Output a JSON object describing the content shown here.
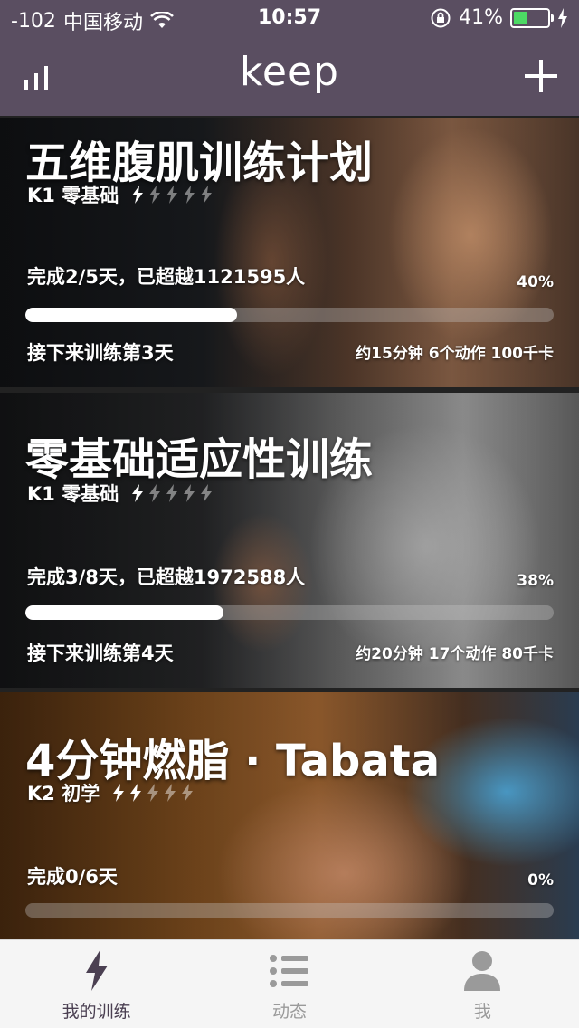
{
  "status_bar": {
    "signal": "-102",
    "carrier": "中国移动",
    "time": "10:57",
    "battery_percent": "41%",
    "battery_level": 0.41
  },
  "nav": {
    "logo": "keep",
    "stats_icon": "bar-chart-icon",
    "add_icon": "plus-icon"
  },
  "cards": [
    {
      "title": "五维腹肌训练计划",
      "level": "K1 零基础",
      "difficulty": 1,
      "difficulty_max": 5,
      "progress_text": "完成2/5天，已超越1121595人",
      "percent": "40%",
      "progress": 0.4,
      "next": "接下来训练第3天",
      "summary": "约15分钟 6个动作 100千卡"
    },
    {
      "title": "零基础适应性训练",
      "level": "K1 零基础",
      "difficulty": 1,
      "difficulty_max": 5,
      "progress_text": "完成3/8天，已超越1972588人",
      "percent": "38%",
      "progress": 0.375,
      "next": "接下来训练第4天",
      "summary": "约20分钟 17个动作 80千卡"
    },
    {
      "title": "4分钟燃脂 · Tabata",
      "level": "K2 初学",
      "difficulty": 2,
      "difficulty_max": 5,
      "progress_text": "完成0/6天",
      "percent": "0%",
      "progress": 0.0,
      "next": "",
      "summary": ""
    }
  ],
  "tabs": [
    {
      "label": "我的训练",
      "icon": "lightning-icon",
      "active": true
    },
    {
      "label": "动态",
      "icon": "list-icon",
      "active": false
    },
    {
      "label": "我",
      "icon": "user-icon",
      "active": false
    }
  ],
  "colors": {
    "header": "#5a4e61",
    "battery": "#4cd964",
    "tab_active": "#4b4052",
    "tab_inactive": "#9a9a9a"
  }
}
